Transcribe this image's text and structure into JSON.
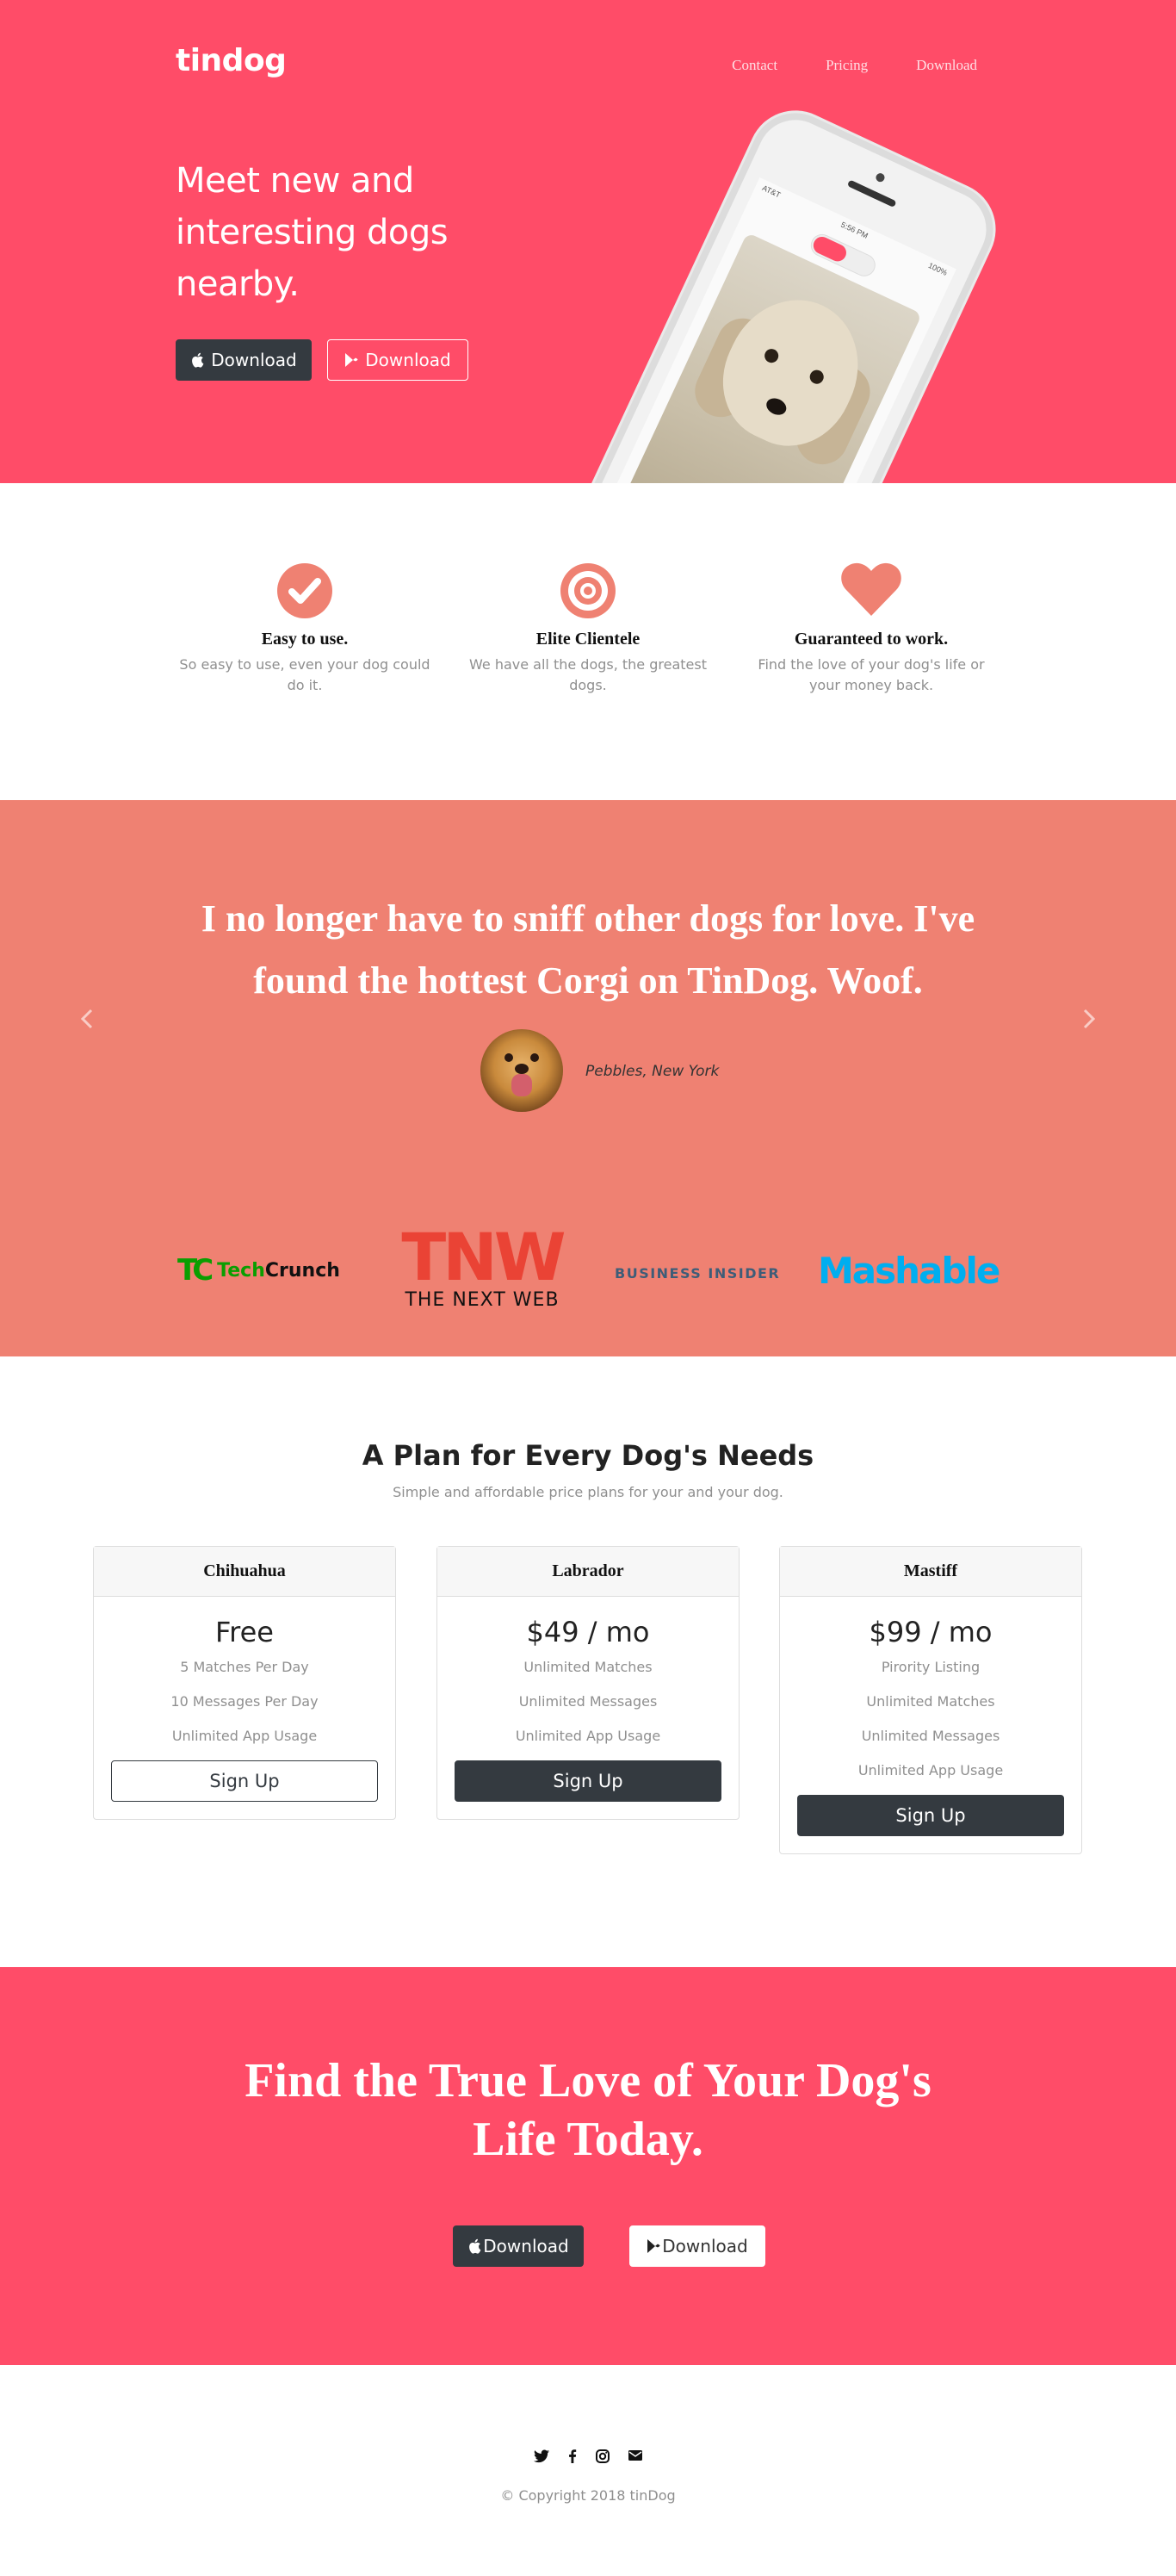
{
  "nav": {
    "brand": "tindog",
    "links": [
      "Contact",
      "Pricing",
      "Download"
    ]
  },
  "hero": {
    "title": "Meet new and interesting dogs nearby.",
    "download_apple": "Download",
    "download_play": "Download",
    "phone_status": {
      "carrier": "AT&T",
      "time": "5:56 PM",
      "battery": "100%"
    }
  },
  "features": [
    {
      "icon": "check-circle-icon",
      "title": "Easy to use.",
      "text": "So easy to use, even your dog could do it."
    },
    {
      "icon": "bullseye-icon",
      "title": "Elite Clientele",
      "text": "We have all the dogs, the greatest dogs."
    },
    {
      "icon": "heart-icon",
      "title": "Guaranteed to work.",
      "text": "Find the love of your dog's life or your money back."
    }
  ],
  "testimonial": {
    "quote": "I no longer have to sniff other dogs for love. I've found the hottest Corgi on TinDog. Woof.",
    "author": "Pebbles, New York"
  },
  "press": {
    "techcrunch": {
      "mark": "TC",
      "tech": "Tech",
      "crunch": "Crunch"
    },
    "tnw": {
      "mark": "TNW",
      "sub": "THE NEXT WEB"
    },
    "business_insider": "BUSINESS INSIDER",
    "mashable": "Mashable"
  },
  "pricing": {
    "title": "A Plan for Every Dog's Needs",
    "subtitle": "Simple and affordable price plans for your and your dog.",
    "plans": [
      {
        "name": "Chihuahua",
        "price": "Free",
        "features": [
          "5 Matches Per Day",
          "10 Messages Per Day",
          "Unlimited App Usage"
        ],
        "cta": "Sign Up"
      },
      {
        "name": "Labrador",
        "price": "$49 / mo",
        "features": [
          "Unlimited Matches",
          "Unlimited Messages",
          "Unlimited App Usage"
        ],
        "cta": "Sign Up"
      },
      {
        "name": "Mastiff",
        "price": "$99 / mo",
        "features": [
          "Pirority Listing",
          "Unlimited Matches",
          "Unlimited Messages",
          "Unlimited App Usage"
        ],
        "cta": "Sign Up"
      }
    ]
  },
  "cta": {
    "title": "Find the True Love of Your Dog's Life Today.",
    "download_apple": "Download",
    "download_play": "Download"
  },
  "footer": {
    "social": [
      "twitter-icon",
      "facebook-icon",
      "instagram-icon",
      "envelope-icon"
    ],
    "copyright": "© Copyright 2018 tinDog"
  },
  "colors": {
    "hero_bg": "#ff4c68",
    "testimonial_bg": "#ef8172",
    "dark": "#343a40",
    "feature_icon": "#ef8172"
  }
}
